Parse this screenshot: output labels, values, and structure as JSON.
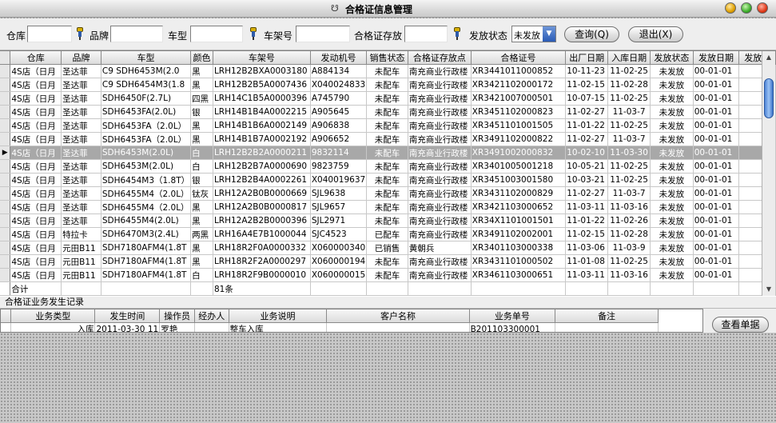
{
  "window": {
    "title": "合格证信息管理",
    "icon": "car-logo-icon"
  },
  "filters": {
    "warehouse_label": "仓库",
    "warehouse_value": "",
    "brand_label": "品牌",
    "brand_value": "",
    "model_label": "车型",
    "model_value": "",
    "vin_label": "车架号",
    "vin_value": "",
    "location_label": "合格证存放",
    "location_value": "",
    "status_label": "发放状态",
    "status_value": "未发放",
    "query_button": "查询(Q)",
    "exit_button": "退出(X)"
  },
  "grid": {
    "columns": [
      "仓库",
      "品牌",
      "车型",
      "颜色",
      "车架号",
      "发动机号",
      "销售状态",
      "合格证存放点",
      "合格证号",
      "出厂日期",
      "入库日期",
      "发放状态",
      "发放日期",
      "发放人"
    ],
    "rows": [
      [
        "4S店（日月",
        "圣达菲",
        "C9  SDH6453M(2.0",
        "黑",
        "LRH12B2BXA0003180",
        "A884134",
        "未配车",
        "南充商业行政楼",
        "XR3441011000852",
        "10-11-23",
        "11-02-25",
        "未发放",
        "00-01-01",
        ""
      ],
      [
        "4S店（日月",
        "圣达菲",
        "C9 SDH6454M3(1.8",
        "黑",
        "LRH12B2B5A0007436",
        "X040024833",
        "未配车",
        "南充商业行政楼",
        "XR3421102000172",
        "11-02-15",
        "11-02-28",
        "未发放",
        "00-01-01",
        ""
      ],
      [
        "4S店（日月",
        "圣达菲",
        "SDH6450F(2.7L)",
        "四黑",
        "LRH14C1B5A0000396",
        "A745790",
        "未配车",
        "南充商业行政楼",
        "XR3421007000501",
        "10-07-15",
        "11-02-25",
        "未发放",
        "00-01-01",
        ""
      ],
      [
        "4S店（日月",
        "圣达菲",
        "SDH6453FA(2.0L)",
        "银",
        "LRH14B1B4A0002215",
        "A905645",
        "未配车",
        "南充商业行政楼",
        "XR3451102000823",
        "11-02-27",
        "11-03-7",
        "未发放",
        "00-01-01",
        ""
      ],
      [
        "4S店（日月",
        "圣达菲",
        "SDH6453FA（2.0L）",
        "黑",
        "LRH14B1B6A0002149",
        "A906838",
        "未配车",
        "南充商业行政楼",
        "XR3451101001505",
        "11-01-22",
        "11-02-25",
        "未发放",
        "00-01-01",
        ""
      ],
      [
        "4S店（日月",
        "圣达菲",
        "SDH6453FA（2.0L）",
        "黑",
        "LRH14B1B7A0002192",
        "A906652",
        "未配车",
        "南充商业行政楼",
        "XR3491102000822",
        "11-02-27",
        "11-03-7",
        "未发放",
        "00-01-01",
        ""
      ],
      [
        "4S店（日月",
        "圣达菲",
        "SDH6453M(2.0L)",
        "白",
        "LRH12B2B2A0000211",
        "9832114",
        "未配车",
        "南充商业行政楼",
        "XR3491002000832",
        "10-02-10",
        "11-03-30",
        "未发放",
        "00-01-01",
        ""
      ],
      [
        "4S店（日月",
        "圣达菲",
        "SDH6453M(2.0L)",
        "白",
        "LRH12B2B7A0000690",
        "9823759",
        "未配车",
        "南充商业行政楼",
        "XR3401005001218",
        "10-05-21",
        "11-02-25",
        "未发放",
        "00-01-01",
        ""
      ],
      [
        "4S店（日月",
        "圣达菲",
        "SDH6454M3（1.8T）",
        "银",
        "LRH12B2B4A0002261",
        "X040019637",
        "未配车",
        "南充商业行政楼",
        "XR3451003001580",
        "10-03-21",
        "11-02-25",
        "未发放",
        "00-01-01",
        ""
      ],
      [
        "4S店（日月",
        "圣达菲",
        "SDH6455M4（2.0L）",
        "钛灰",
        "LRH12A2B0B0000669",
        "SJL9638",
        "未配车",
        "南充商业行政楼",
        "XR3431102000829",
        "11-02-27",
        "11-03-7",
        "未发放",
        "00-01-01",
        ""
      ],
      [
        "4S店（日月",
        "圣达菲",
        "SDH6455M4（2.0L）",
        "黑",
        "LRH12A2B0B0000817",
        "SJL9657",
        "未配车",
        "南充商业行政楼",
        "XR3421103000652",
        "11-03-11",
        "11-03-16",
        "未发放",
        "00-01-01",
        ""
      ],
      [
        "4S店（日月",
        "圣达菲",
        "SDH6455M4(2.0L)",
        "黑",
        "LRH12A2B2B0000396",
        "SJL2971",
        "未配车",
        "南充商业行政楼",
        "XR34X1101001501",
        "11-01-22",
        "11-02-26",
        "未发放",
        "00-01-01",
        ""
      ],
      [
        "4S店（日月",
        "特拉卡",
        "SDH6470M3(2.4L)",
        "两黑",
        "LRH16A4E7B1000044",
        "SJC4523",
        "已配车",
        "南充商业行政楼",
        "XR3491102002001",
        "11-02-15",
        "11-02-28",
        "未发放",
        "00-01-01",
        ""
      ],
      [
        "4S店（日月",
        "元田B11",
        "SDH7180AFM4(1.8T",
        "黑",
        "LRH18R2F0A0000332",
        "X060000340",
        "已销售",
        "黄朝兵",
        "XR3401103000338",
        "11-03-06",
        "11-03-9",
        "未发放",
        "00-01-01",
        ""
      ],
      [
        "4S店（日月",
        "元田B11",
        "SDH7180AFM4(1.8T",
        "黑",
        "LRH18R2F2A0000297",
        "X060000194",
        "未配车",
        "南充商业行政楼",
        "XR3431101000502",
        "11-01-08",
        "11-02-25",
        "未发放",
        "00-01-01",
        ""
      ],
      [
        "4S店（日月",
        "元田B11",
        "SDH7180AFM4(1.8T",
        "白",
        "LRH18R2F9B0000010",
        "X060000015",
        "未配车",
        "南充商业行政楼",
        "XR3461103000651",
        "11-03-11",
        "11-03-16",
        "未发放",
        "00-01-01",
        ""
      ]
    ],
    "selected_row_index": 6,
    "total_label": "合计",
    "total_count": "81条"
  },
  "history": {
    "section_label": "合格证业务发生记录",
    "columns": [
      "业务类型",
      "发生时间",
      "操作员",
      "经办人",
      "业务说明",
      "客户名称",
      "业务单号",
      "备注"
    ],
    "rows": [
      [
        "入库",
        "2011-03-30 11",
        "罗艳",
        "",
        "整车入库",
        "",
        "B201103300001",
        ""
      ]
    ],
    "view_button": "查看单据"
  },
  "colors": {
    "selected_row": "#a8a8a8",
    "scroll_thumb": "#4f86d8",
    "status_select_arrow": "#2a5bb6"
  }
}
